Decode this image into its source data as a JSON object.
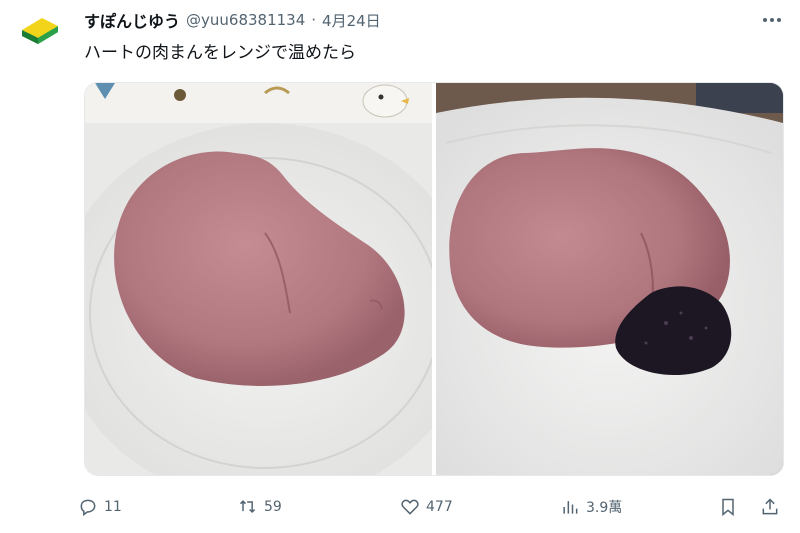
{
  "user": {
    "display_name": "すぽんじゆう",
    "handle": "@yuu68381134",
    "separator": "·",
    "date": "4月24日"
  },
  "tweet": {
    "text": "ハートの肉まんをレンジで温めたら"
  },
  "media": {
    "photos": [
      {
        "name": "heart-bun-photo-left"
      },
      {
        "name": "heart-bun-photo-right"
      }
    ]
  },
  "actions": {
    "replies": "11",
    "reposts": "59",
    "likes": "477",
    "views": "3.9萬"
  },
  "colors": {
    "text": "#0f1419",
    "muted": "#536471",
    "bun": "#b97b84",
    "filling": "#1c1722"
  }
}
